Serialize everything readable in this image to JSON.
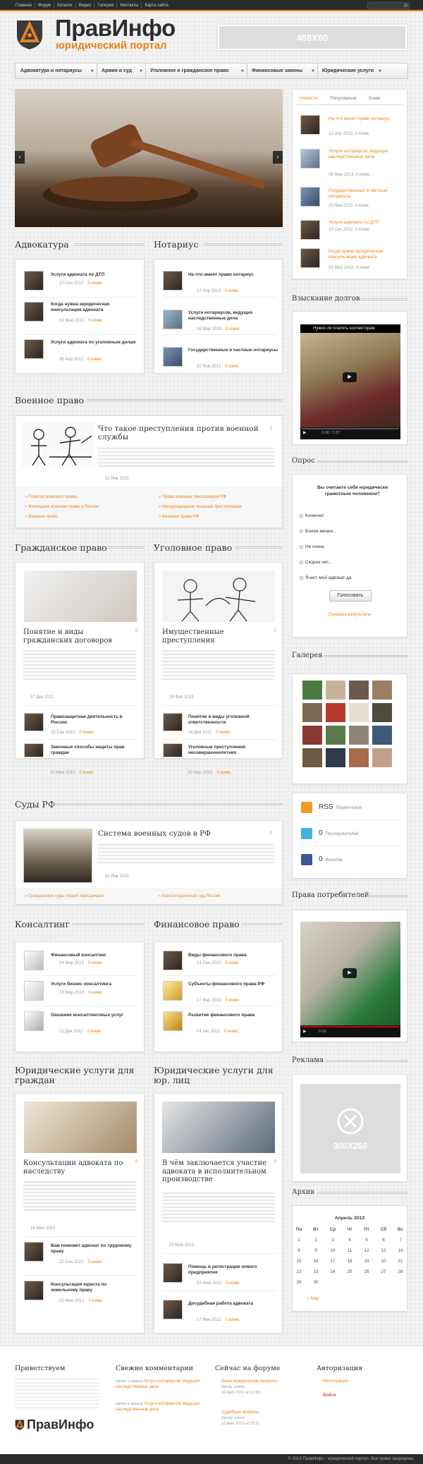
{
  "topnav": [
    "Главная",
    "Форум",
    "Каталог",
    "Видео",
    "Галерея",
    "Контакты",
    "Карта сайта"
  ],
  "logo": {
    "title": "ПравИнфо",
    "subtitle": "юридический портал"
  },
  "banner_top": "468X60",
  "mainnav": [
    "Адвокатура и нотариусы",
    "Армия и суд",
    "Уголовное и гражданское право",
    "Финансовые законы",
    "Юридические услуги"
  ],
  "advokatura": {
    "title": "Адвокатура",
    "items": [
      {
        "title": "Услуги адвоката по ДТП",
        "date": "10 Сен 2012",
        "comments": "0 комм."
      },
      {
        "title": "Когда нужна юридическая консультация адвоката",
        "date": "03 Май 2012",
        "comments": "0 комм."
      },
      {
        "title": "Услуги адвоката по уголовным делам",
        "date": "26 Апр 2012",
        "comments": "0 комм."
      }
    ]
  },
  "notarius": {
    "title": "Нотариус",
    "items": [
      {
        "title": "На что имеет право нотариус",
        "date": "12 Апр 2013",
        "comments": "0 комм."
      },
      {
        "title": "Услуги нотариусов, ведущих наследственные дела",
        "date": "08 Мар 2013",
        "comments": "0 комм."
      },
      {
        "title": "Государственные и частные нотариусы",
        "date": "20 Янв 2013",
        "comments": "0 комм."
      }
    ]
  },
  "military": {
    "title": "Военное право",
    "feature": "Что такое преступления против военной службы",
    "date": "11 Янв 2013",
    "count": "0",
    "links_left": [
      "Понятие военного права",
      "Жилищное военное право в России",
      "Военное право"
    ],
    "links_right": [
      "Права военных пенсионеров РФ",
      "Международные военные преступления",
      "Военное право РФ"
    ]
  },
  "civil": {
    "title": "Гражданское право",
    "feature": "Понятие и виды гражданских договоров",
    "date": "27 Дек 2012",
    "count": "0",
    "items": [
      {
        "title": "Правозащитная деятельность в России",
        "date": "25 Сен 2012",
        "comments": "0 комм."
      },
      {
        "title": "Законные способы защиты прав граждан",
        "date": "10 Июн 2012",
        "comments": "0 комм."
      }
    ]
  },
  "criminal": {
    "title": "Уголовное право",
    "feature": "Имущественные преступления",
    "date": "25 Фев 2013",
    "count": "0",
    "items": [
      {
        "title": "Понятие и виды уголовной ответственности",
        "date": "24 Дек 2012",
        "comments": "0 комм."
      },
      {
        "title": "Уголовные преступления несовершеннолетних",
        "date": "20 Июн 2012",
        "comments": "0 комм."
      }
    ]
  },
  "courts": {
    "title": "Суды РФ",
    "feature": "Система военных судов в РФ",
    "date": "11 Янв 2013",
    "count": "0",
    "link_left": "Гражданские суды общей юрисдикции",
    "link_right": "Конституционный суд России"
  },
  "consulting": {
    "title": "Консалтинг",
    "items": [
      {
        "title": "Финансовый консалтинг",
        "date": "24 Мар 2013",
        "comments": "0 комм."
      },
      {
        "title": "Услуги бизнес консалтинга",
        "date": "23 Мар 2013",
        "comments": "0 комм."
      },
      {
        "title": "Оказание консалтинговых услуг",
        "date": "21 Дек 2012",
        "comments": "0 комм."
      }
    ]
  },
  "finance": {
    "title": "Финансовое право",
    "items": [
      {
        "title": "Виды финансового права",
        "date": "13 Сен 2012",
        "comments": "0 комм."
      },
      {
        "title": "Субъекты финансового права РФ",
        "date": "17 Фев 2012",
        "comments": "0 комм."
      },
      {
        "title": "Развитие финансового права",
        "date": "04 Авг 2012",
        "comments": "0 комм."
      }
    ]
  },
  "services_citizens": {
    "title": "Юридические услуги для граждан",
    "feature": "Консультации адвоката по наследству",
    "date": "18 Июн 2012",
    "count": "0",
    "items": [
      {
        "title": "Вам поможет адвокат по трудовому праву",
        "date": "22 Сен 2012",
        "comments": "0 комм."
      },
      {
        "title": "Консультация юриста по земельному праву",
        "date": "15 Июн 2012",
        "comments": "0 комм."
      }
    ]
  },
  "services_legal": {
    "title": "Юридические услуги для юр. лиц",
    "feature": "В чём заключается участие адвоката в исполнительном производстве",
    "date": "23 Май 2012",
    "count": "0",
    "items": [
      {
        "title": "Помощь в регистрации нового предприятия",
        "date": "03 Май 2012",
        "comments": "0 комм."
      },
      {
        "title": "Досудебная работа адвоката",
        "date": "17 Фев 2012",
        "comments": "0 комм."
      }
    ]
  },
  "sidebar": {
    "tabs": [
      "Новости",
      "Популярные",
      "Комм."
    ],
    "news": [
      {
        "title": "На что имеет право нотариус",
        "date": "12 Апр 2013,",
        "comments": "0 комм."
      },
      {
        "title": "Услуги нотариусов, ведущих наследственные дела",
        "date": "08 Мар 2013,",
        "comments": "0 комм."
      },
      {
        "title": "Государственные и частные нотариусы",
        "date": "20 Янв 2013,",
        "comments": "0 комм."
      },
      {
        "title": "Услуги адвоката по ДТП",
        "date": "10 Сен 2012,",
        "comments": "0 комм."
      },
      {
        "title": "Когда нужна юридическая консультация адвоката",
        "date": "03 Май 2012,",
        "comments": "0 комм."
      }
    ],
    "debt_title": "Взыскание долгов",
    "video1_title": "Нужно ли платить коллекторам",
    "video1_time": "0:00 / 1:37",
    "poll_title": "Опрос",
    "poll_question": "Вы считаете себя юридически грамотным человеком?",
    "poll_options": [
      "Конечно!",
      "Более-менее...",
      "Не очень",
      "Скорее нет...",
      "Я-нет, мой адвокат-да"
    ],
    "poll_button": "Голосовать",
    "poll_results": "Показать результаты",
    "gallery_title": "Галерея",
    "rss_count": "RSS",
    "rss_label": "Подписчиков",
    "tw_count": "0",
    "tw_label": "Последователей",
    "fb_count": "0",
    "fb_label": "Фанатов",
    "consumer_title": "Права потребителей",
    "video2_time": "0:00",
    "ad_title": "Реклама",
    "ad_label": "300X250",
    "archive_title": "Архив",
    "cal_month": "Апрель 2013",
    "cal_head": [
      "Пн",
      "Вт",
      "Ср",
      "Чт",
      "Пт",
      "Сб",
      "Вс"
    ],
    "cal_rows": [
      [
        "1",
        "2",
        "3",
        "4",
        "5",
        "6",
        "7"
      ],
      [
        "8",
        "9",
        "10",
        "11",
        "12",
        "13",
        "14"
      ],
      [
        "15",
        "16",
        "17",
        "18",
        "19",
        "20",
        "21"
      ],
      [
        "22",
        "23",
        "24",
        "25",
        "26",
        "27",
        "28"
      ],
      [
        "29",
        "30",
        "",
        "",
        "",
        "",
        ""
      ]
    ],
    "cal_prev": "« Мар"
  },
  "footer": {
    "welcome_title": "Приветствуем",
    "comments_title": "Свежие комментарии",
    "comments": [
      {
        "author": "admin",
        "prefix": "к записи",
        "link": "Услуги нотариусов, ведущих наследственные дела"
      },
      {
        "author": "admin",
        "prefix": "к записи",
        "link": "Услуги нотариусов, ведущих наследственные дела"
      }
    ],
    "forum_title": "Сейчас на форуме",
    "forum": [
      {
        "title": "Иные юридические вопросы",
        "author": "Автор: admin",
        "date": "10 April 2013 at 12:30"
      },
      {
        "title": "Судебные вопросы",
        "author": "Автор: admin",
        "date": "10 April 2013 at 12:37"
      }
    ],
    "auth_title": "Авторизация",
    "auth_links": [
      "Регистрация",
      "Войти"
    ],
    "copyright": "© 2013 ПравИнфо - юридический портал. Все права защищены."
  },
  "colors": {
    "accent": "#e8831b",
    "dark": "#2b2b2b"
  }
}
